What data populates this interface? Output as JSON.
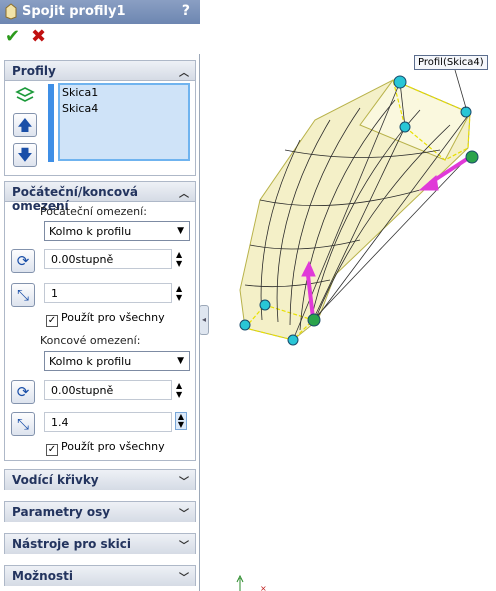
{
  "panel": {
    "title": "Spojit profily1",
    "help": "?",
    "ok": "✔",
    "cancel": "✖"
  },
  "profiles": {
    "header": "Profily",
    "items": [
      "Skica1",
      "Skica4"
    ]
  },
  "constraints": {
    "header": "Počáteční/koncová omezení",
    "start_label": "Počáteční omezení:",
    "start_value": "Kolmo k profilu",
    "start_angle": "0.00stupně",
    "start_tangent": "1",
    "start_apply_all": "Použít pro všechny",
    "end_label": "Koncové omezení:",
    "end_value": "Kolmo k profilu",
    "end_angle": "0.00stupně",
    "end_tangent": "1.4",
    "end_apply_all": "Použít pro všechny"
  },
  "collapsed_groups": [
    "Vodící křivky",
    "Parametry osy",
    "Nástroje pro skici",
    "Možnosti"
  ],
  "viewport": {
    "callout": "Profil(Skica4)"
  },
  "colors": {
    "title_bar": "#7a93bd",
    "accent_blue": "#3f8fe6",
    "handle_magenta": "#e03ad8",
    "handle_cyan": "#29c6d6",
    "handle_green": "#2aa34b"
  }
}
